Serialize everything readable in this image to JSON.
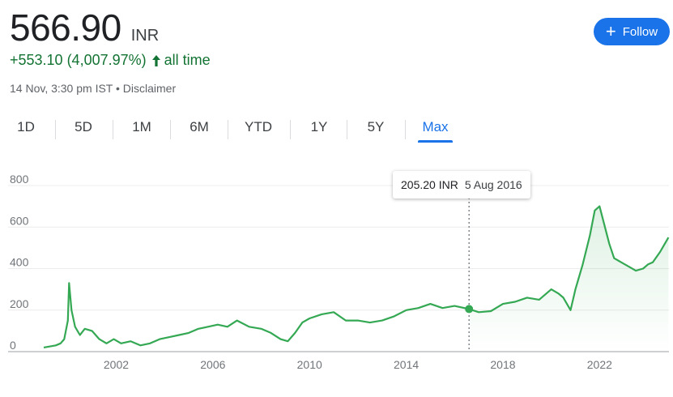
{
  "header": {
    "price": "566.90",
    "currency": "INR",
    "change": "+553.10 (4,007.97%)",
    "change_period": "all time",
    "timestamp": "14 Nov, 3:30 pm IST",
    "separator": "•",
    "disclaimer": "Disclaimer",
    "follow_label": "Follow"
  },
  "tabs": [
    {
      "label": "1D",
      "active": false
    },
    {
      "label": "5D",
      "active": false
    },
    {
      "label": "1M",
      "active": false
    },
    {
      "label": "6M",
      "active": false
    },
    {
      "label": "YTD",
      "active": false
    },
    {
      "label": "1Y",
      "active": false
    },
    {
      "label": "5Y",
      "active": false
    },
    {
      "label": "Max",
      "active": true
    }
  ],
  "tooltip": {
    "value": "205.20 INR",
    "date": "5 Aug 2016"
  },
  "colors": {
    "line": "#34a853",
    "accent": "#1a73e8",
    "positive": "#137333"
  },
  "chart_data": {
    "type": "line",
    "y_ticks": [
      "0",
      "200",
      "400",
      "600",
      "800"
    ],
    "x_ticks": [
      "2002",
      "2006",
      "2010",
      "2014",
      "2018",
      "2022"
    ],
    "ylim": [
      0,
      800
    ],
    "xlim": [
      1998.7,
      2024.87
    ],
    "grid": true,
    "highlight": {
      "x": 2016.6,
      "y": 205.2
    },
    "series": [
      {
        "x": [
          1999.0,
          1999.5,
          1999.7,
          1999.85,
          2000.0,
          2000.05,
          2000.15,
          2000.3,
          2000.5,
          2000.7,
          2001.0,
          2001.3,
          2001.6,
          2001.9,
          2002.2,
          2002.6,
          2003.0,
          2003.4,
          2003.8,
          2004.2,
          2004.6,
          2005.0,
          2005.4,
          2005.8,
          2006.2,
          2006.6,
          2007.0,
          2007.5,
          2008.0,
          2008.4,
          2008.8,
          2009.1,
          2009.4,
          2009.7,
          2010.0,
          2010.5,
          2011.0,
          2011.5,
          2012.0,
          2012.5,
          2013.0,
          2013.5,
          2014.0,
          2014.5,
          2015.0,
          2015.5,
          2016.0,
          2016.6,
          2017.0,
          2017.5,
          2018.0,
          2018.5,
          2019.0,
          2019.5,
          2020.0,
          2020.3,
          2020.5,
          2020.8,
          2021.0,
          2021.3,
          2021.6,
          2021.8,
          2022.0,
          2022.2,
          2022.4,
          2022.6,
          2022.9,
          2023.2,
          2023.5,
          2023.8,
          2024.0,
          2024.2,
          2024.5,
          2024.7,
          2024.85
        ],
        "y": [
          20,
          30,
          40,
          60,
          150,
          330,
          200,
          120,
          80,
          110,
          100,
          60,
          40,
          60,
          40,
          50,
          30,
          40,
          60,
          70,
          80,
          90,
          110,
          120,
          130,
          120,
          150,
          120,
          110,
          90,
          60,
          50,
          90,
          140,
          160,
          180,
          190,
          150,
          150,
          140,
          150,
          170,
          200,
          210,
          230,
          210,
          220,
          205,
          190,
          195,
          230,
          240,
          260,
          250,
          300,
          280,
          260,
          200,
          300,
          420,
          560,
          680,
          700,
          610,
          520,
          450,
          430,
          410,
          390,
          400,
          420,
          430,
          480,
          520,
          550
        ]
      }
    ]
  }
}
